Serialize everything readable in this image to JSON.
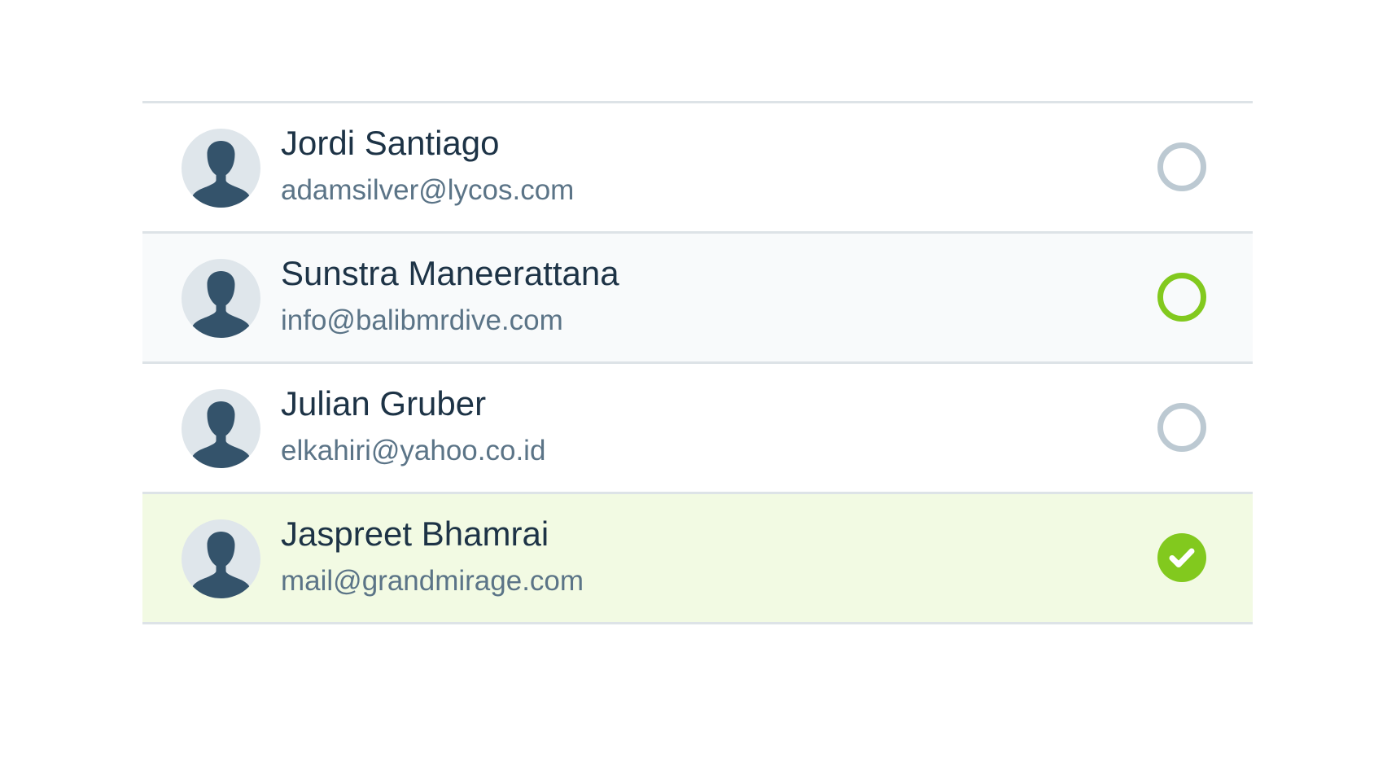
{
  "contacts": [
    {
      "name": "Jordi Santiago",
      "email": "adamsilver@lycos.com",
      "selected": false,
      "state": "default"
    },
    {
      "name": "Sunstra Maneerattana",
      "email": "info@balibmrdive.com",
      "selected": false,
      "state": "hover"
    },
    {
      "name": "Julian Gruber",
      "email": "elkahiri@yahoo.co.id",
      "selected": false,
      "state": "default"
    },
    {
      "name": "Jaspreet Bhamrai",
      "email": "mail@grandmirage.com",
      "selected": true,
      "state": "selected"
    }
  ],
  "icons": {
    "avatar": "person-silhouette-icon",
    "radio": "radio-circle-icon",
    "checked": "checkmark-icon"
  },
  "colors": {
    "accent": "#82c91e",
    "selected_row_bg": "#f2fae3",
    "hover_row_bg": "#f8fafb",
    "radio_idle": "#bcc9d2",
    "name_text": "#1d3346",
    "email_text": "#5b7487",
    "avatar_bg": "#dfe6eb",
    "avatar_fg": "#34536b"
  }
}
